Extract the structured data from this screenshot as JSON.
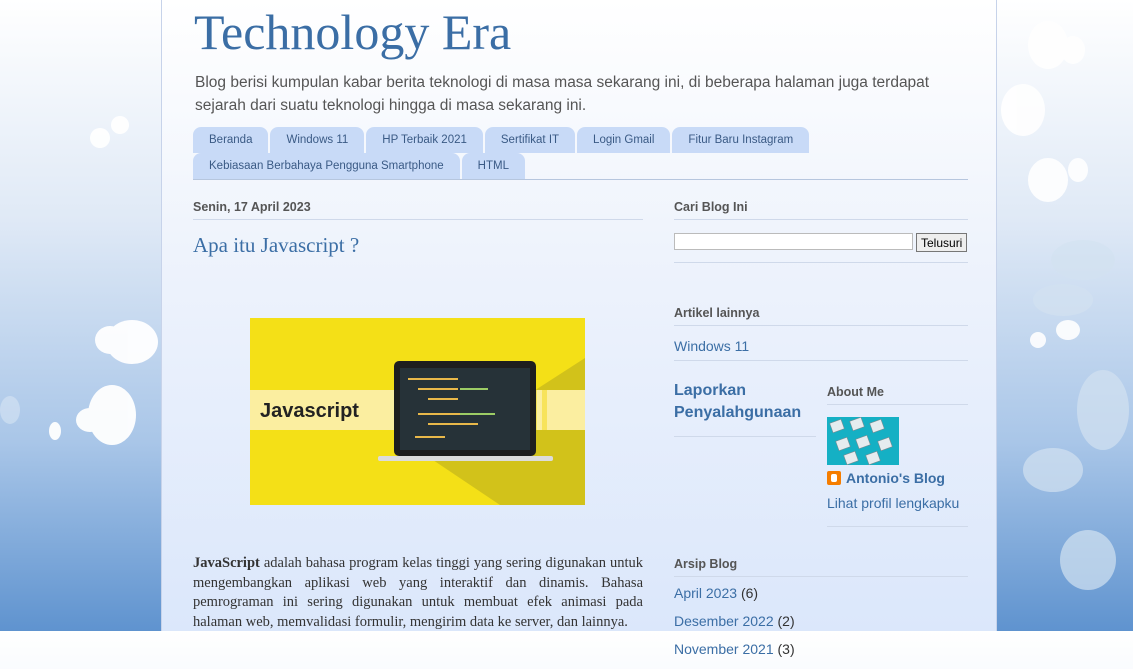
{
  "blog": {
    "title": "Technology Era",
    "description": "Blog berisi kumpulan kabar berita teknologi di masa masa sekarang ini, di beberapa halaman juga terdapat sejarah dari suatu teknologi hingga di masa sekarang ini."
  },
  "tabs": [
    "Beranda",
    "Windows 11",
    "HP Terbaik 2021",
    "Sertifikat IT",
    "Login Gmail",
    "Fitur Baru Instagram",
    "Kebiasaan Berbahaya Pengguna Smartphone",
    "HTML"
  ],
  "post": {
    "date": "Senin, 17 April 2023",
    "title": "Apa itu Javascript ?",
    "image_label": "Javascript",
    "body_bold": "JavaScript",
    "body_rest": " adalah bahasa program kelas tinggi yang sering digunakan untuk mengembangkan aplikasi web yang interaktif dan dinamis. Bahasa pemrograman ini sering digunakan untuk membuat efek animasi pada halaman web, memvalidasi formulir, mengirim data ke server, dan lainnya."
  },
  "sidebar": {
    "search_heading": "Cari Blog Ini",
    "search_button": "Telusuri",
    "search_value": "",
    "other_articles_heading": "Artikel lainnya",
    "other_article": "Windows 11",
    "report_label": "Laporkan Penyalahgunaan",
    "about_heading": "About Me",
    "profile_name": "Antonio's Blog",
    "profile_link": "Lihat profil lengkapku",
    "archive_heading": "Arsip Blog",
    "archive": [
      {
        "month": "April 2023",
        "count": "(6)"
      },
      {
        "month": "Desember 2022",
        "count": "(2)"
      },
      {
        "month": "November 2021",
        "count": "(3)"
      }
    ]
  },
  "colors": {
    "link": "#3b6ea5",
    "tab_bg": "#c8daf7",
    "image_bg": "#f4e017"
  }
}
